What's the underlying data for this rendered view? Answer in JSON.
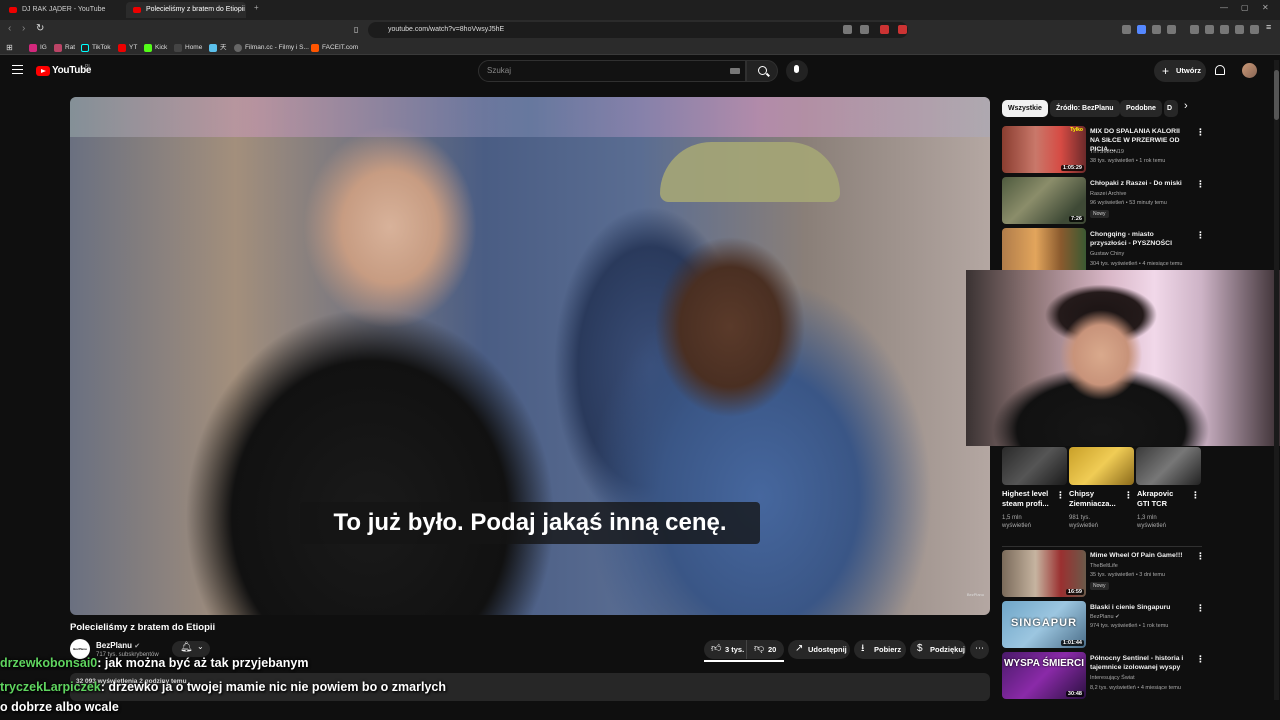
{
  "browser": {
    "tabs": [
      {
        "title": "DJ RAK JĄDER - YouTube"
      },
      {
        "title": "Polecieliśmy z bratem do Etiopii"
      }
    ],
    "url": "youtube.com/watch?v=8hoVwsyJ5hE",
    "bookmarks": [
      "IG",
      "Rat",
      "TikTok",
      "YT",
      "Kick",
      "Home",
      "天",
      "Filman.cc - Filmy i S...",
      "FACEIT.com"
    ]
  },
  "header": {
    "logo_text": "YouTube",
    "country": "PL",
    "search_placeholder": "Szukaj",
    "create_label": "Utwórz"
  },
  "video": {
    "subtitle": "To już było. Podaj jakąś inną cenę.",
    "watermark": "BezPlanu",
    "title": "Polecieliśmy z bratem do Etiopii",
    "channel": "BezPlanu",
    "channel_avatar_text": "BezPlanu",
    "subscribers": "717 tys. subskrybentów",
    "likes": "3 tys.",
    "comments": "20",
    "share_label": "Udostępnij",
    "download_label": "Pobierz",
    "thanks_label": "Podziękuj",
    "desc_meta": "32 093 wyświetlenia  2 godziny temu"
  },
  "chat": [
    {
      "user": "drzewkobonsai0",
      "text": ": jak można być aż tak przyjebanym"
    },
    {
      "user": "tryczekLarpiczek",
      "text": ": drzewko ja o twojej mamie nic nie powiem bo o zmarlych"
    },
    {
      "user": "",
      "text": "o dobrze albo wcale"
    }
  ],
  "sidebar": {
    "chips": [
      "Wszystkie",
      "Źródło: BezPlanu",
      "Podobne",
      "D"
    ],
    "videos": [
      {
        "title": "MIX DO SPALANIA KALORII NA SIŁCE W PRZERWIE OD PICIA ...",
        "channel": "ThTSIMON19",
        "meta": "38 tys. wyświetleń • 1 rok temu",
        "duration": "1:05:29",
        "badge": ""
      },
      {
        "title": "Chłopaki z Raszei - Do miski",
        "channel": "Raszei Archive",
        "meta": "96 wyświetleń • 53 minuty temu",
        "duration": "7:26",
        "badge": "Nowy"
      },
      {
        "title": "Chongqing - miasto przyszłości - PYSZNOŚCI",
        "channel": "Gustaw Chiny",
        "meta": "304 tys. wyświetleń • 4 miesiące temu",
        "duration": "",
        "badge": ""
      },
      {
        "title": "Mime Wheel Of Pain Game!!!",
        "channel": "TheBeltLife",
        "meta": "35 tys. wyświetleń • 3 dni temu",
        "duration": "16:59",
        "badge": "Nowy"
      },
      {
        "title": "Blaski i cienie Singapuru",
        "channel": "BezPlanu",
        "meta": "974 tys. wyświetleń • 1 rok temu",
        "duration": "1:01:44",
        "badge": ""
      },
      {
        "title": "Północny Sentinel - historia i tajemnice izolowanej wyspy",
        "channel": "Interesujący Świat",
        "meta": "8,2 tys. wyświetleń • 4 miesiące temu",
        "duration": "30:48",
        "badge": ""
      }
    ],
    "thumb_texts": [
      "Tylko",
      "SINGAPUR",
      "WYSPA ŚMIERCI"
    ],
    "shorts": [
      {
        "title": "Highest level steam profi...",
        "views": "1,5 mln wyświetleń"
      },
      {
        "title": "Chipsy Ziemniacza...",
        "views": "981 tys. wyświetleń"
      },
      {
        "title": "Akrapovic GTI TCR",
        "views": "1,3 mln wyświetleń"
      }
    ]
  },
  "colors": {
    "bg": "#0f0f0f",
    "accent": "#ff0000",
    "chat_user": "#5fd45f"
  },
  "icons": [
    "menu-icon",
    "search-icon",
    "mic-icon",
    "bell-icon",
    "like-icon",
    "dislike-icon",
    "share-icon",
    "download-icon",
    "thanks-icon",
    "more-icon"
  ]
}
